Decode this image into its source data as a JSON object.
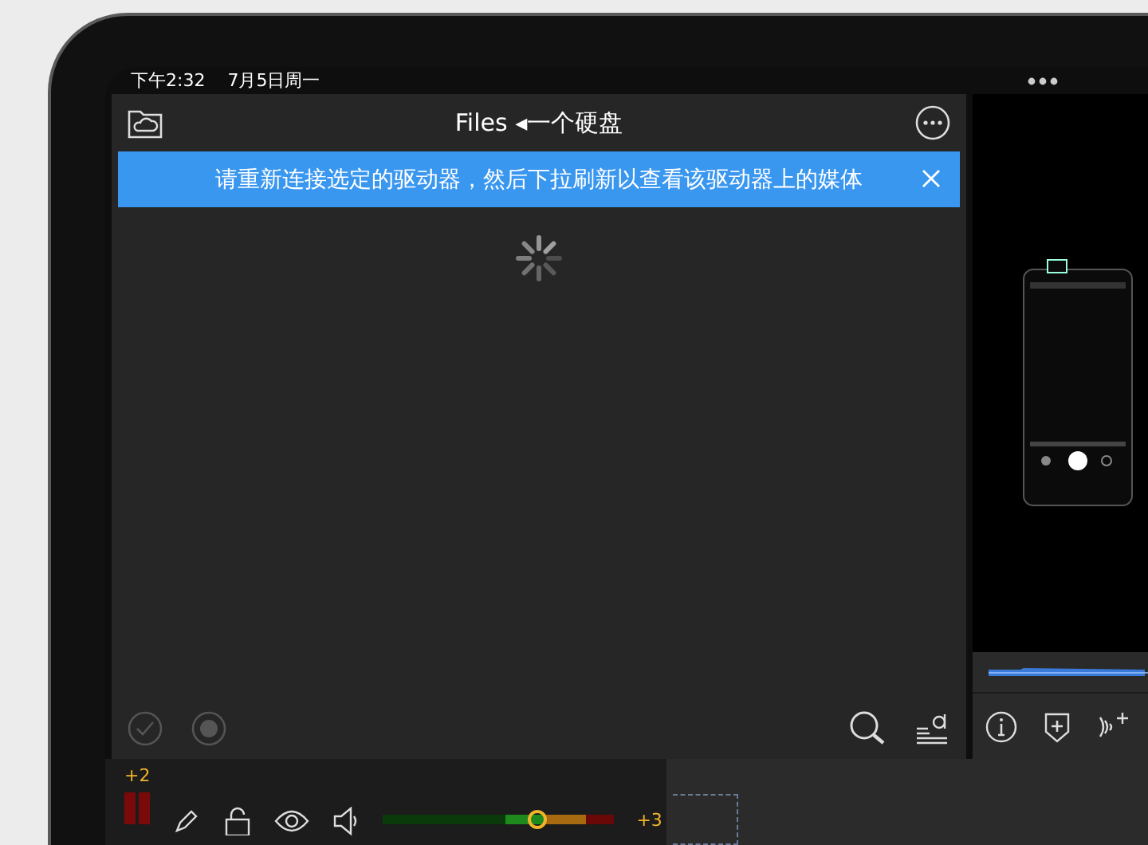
{
  "status_bar": {
    "time": "下午2:32",
    "date": "7月5日周一"
  },
  "files_panel": {
    "title": "Files ◂一个硬盘",
    "loading": true,
    "banner": {
      "message": "请重新连接选定的驱动器，然后下拉刷新以查看该驱动器上的媒体"
    },
    "toolbar": {
      "disabled": true
    }
  },
  "mixer": {
    "gain": "+2",
    "level": 0.68,
    "max": "+3"
  }
}
